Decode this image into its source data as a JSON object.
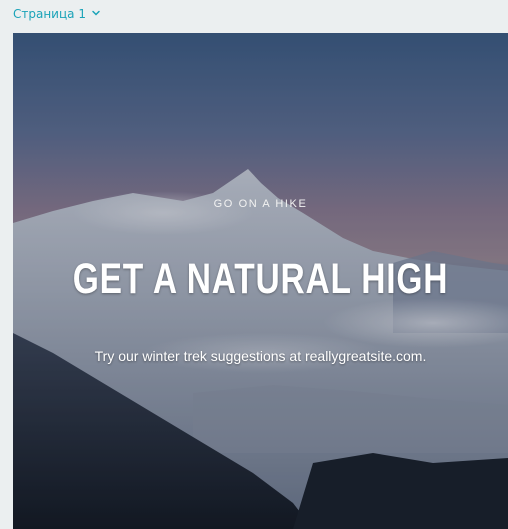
{
  "page_selector": {
    "label": "Страница 1",
    "icon": "chevron-down-icon",
    "color": "#1aa3b8"
  },
  "design": {
    "eyebrow": "GO ON A HIKE",
    "headline": "GET A NATURAL HIGH",
    "subtext": "Try our winter trek suggestions at reallygreatsite.com."
  }
}
